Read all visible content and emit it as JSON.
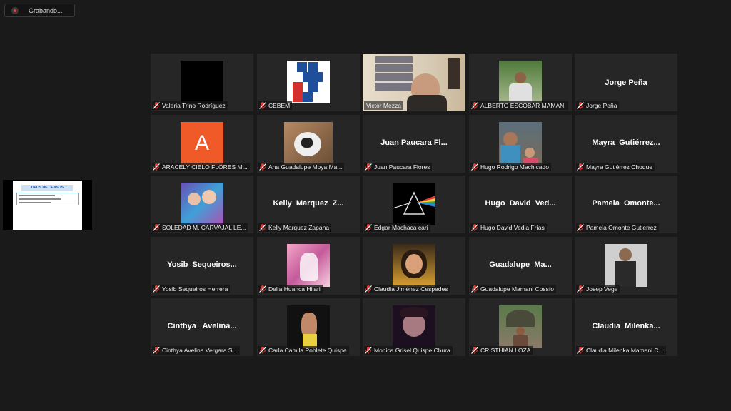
{
  "recording": {
    "label": "Grabando..."
  },
  "shared_screen": {
    "slide_title": "TIPOS DE CENSOS"
  },
  "participants": [
    {
      "label": "Valeria Trino Rodríguez",
      "big": "",
      "muted": true
    },
    {
      "label": "CEBEM",
      "big": "",
      "muted": true
    },
    {
      "label": "Victor Mezza",
      "big": "",
      "muted": false,
      "active": true
    },
    {
      "label": "ALBERTO ESCOBAR MAMANI",
      "big": "",
      "muted": true
    },
    {
      "label": "Jorge Peña",
      "big": "Jorge Peña",
      "muted": true
    },
    {
      "label": "ARACELY CIELO FLORES M...",
      "big": "",
      "muted": true,
      "avatar_letter": "A"
    },
    {
      "label": "Ana Guadalupe Moya Ma...",
      "big": "",
      "muted": true
    },
    {
      "label": "Juan Paucara Flores",
      "big": "Juan Paucara Fl...",
      "muted": true
    },
    {
      "label": "Hugo Rodrigo Machicado",
      "big": "",
      "muted": true
    },
    {
      "label": "Mayra Gutiérrez Choque",
      "big": "Mayra  Gutiérrez...",
      "muted": true
    },
    {
      "label": "SOLEDAD M. CARVAJAL LE...",
      "big": "",
      "muted": true
    },
    {
      "label": "Kelly Marquez Zapana",
      "big": "Kelly  Marquez  Z...",
      "muted": true
    },
    {
      "label": "Edgar Machaca cari",
      "big": "",
      "muted": true
    },
    {
      "label": "Hugo David Vedia Frías",
      "big": "Hugo  David  Ved...",
      "muted": true
    },
    {
      "label": "Pamela Omonte Gutierrez",
      "big": "Pamela  Omonte...",
      "muted": true
    },
    {
      "label": "Yosib Sequeiros Herrera",
      "big": "Yosib  Sequeiros...",
      "muted": true
    },
    {
      "label": "Delia Huanca Hilari",
      "big": "",
      "muted": true
    },
    {
      "label": "Claudia Jiménez Cespedes",
      "big": "",
      "muted": true
    },
    {
      "label": "Guadalupe Mamani Cossío",
      "big": "Guadalupe  Ma...",
      "muted": true
    },
    {
      "label": "Josep Vega",
      "big": "",
      "muted": true
    },
    {
      "label": "Cinthya  Avelina Vergara S...",
      "big": "Cinthya   Avelina...",
      "muted": true
    },
    {
      "label": "Carla Camila Poblete Quispe",
      "big": "",
      "muted": true
    },
    {
      "label": "Monica Grisel Quispe Chura",
      "big": "",
      "muted": true
    },
    {
      "label": "CRISTHIAN LOZA",
      "big": "",
      "muted": true
    },
    {
      "label": "Claudia Milenka Mamani C...",
      "big": "Claudia  Milenka...",
      "muted": true
    }
  ],
  "colors": {
    "background": "#1a1a1a",
    "tile": "#262626",
    "active_border": "#d4e157",
    "muted_mic": "#e53935"
  }
}
